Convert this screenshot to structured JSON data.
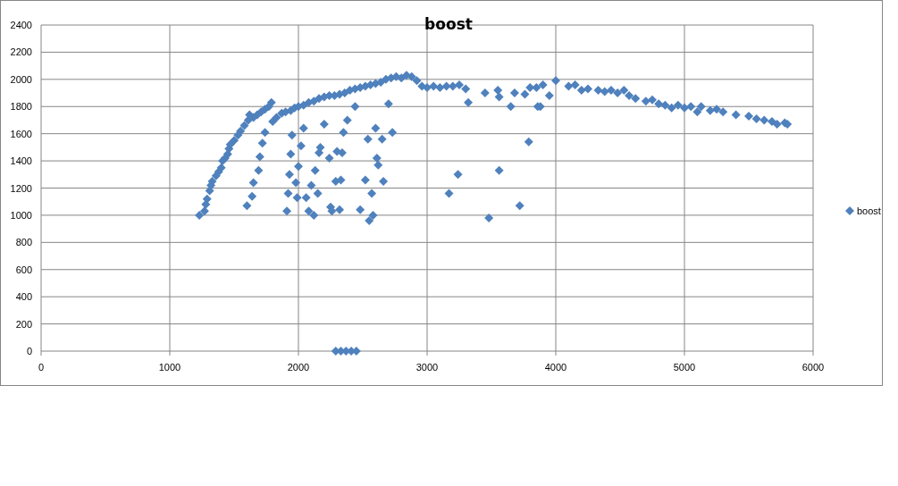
{
  "chart": {
    "chart_data": {
      "type": "scatter",
      "title": "boost",
      "grid": true,
      "xlim": [
        0,
        6000
      ],
      "ylim": [
        0,
        2400
      ],
      "xticks": [
        0,
        1000,
        2000,
        3000,
        4000,
        5000,
        6000
      ],
      "yticks": [
        0,
        200,
        400,
        600,
        800,
        1000,
        1200,
        1400,
        1600,
        1800,
        2000,
        2200,
        2400
      ],
      "x": [
        1230,
        1270,
        1280,
        1290,
        1310,
        1320,
        1330,
        1360,
        1380,
        1400,
        1410,
        1430,
        1450,
        1460,
        1470,
        1500,
        1530,
        1550,
        1580,
        1610,
        1620,
        1650,
        1680,
        1710,
        1740,
        1770,
        1790,
        1800,
        1830,
        1870,
        1900,
        1940,
        1970,
        2000,
        2040,
        2080,
        2120,
        2160,
        2200,
        2240,
        2280,
        2320,
        2360,
        2400,
        2440,
        2480,
        2520,
        2560,
        2600,
        2640,
        2680,
        2720,
        2760,
        2800,
        2840,
        2880,
        2920,
        2960,
        3000,
        3050,
        3100,
        3150,
        3200,
        3250,
        3300,
        3320,
        3450,
        3550,
        3560,
        3650,
        3680,
        3760,
        3800,
        3850,
        3880,
        3900,
        3950,
        4000,
        4100,
        4150,
        4200,
        4250,
        4330,
        4380,
        4430,
        4480,
        4530,
        4570,
        4620,
        4700,
        4750,
        4800,
        4850,
        4900,
        4950,
        5000,
        5050,
        5100,
        5130,
        5200,
        5250,
        5300,
        5400,
        5500,
        5560,
        5620,
        5680,
        5720,
        5780,
        5800,
        1600,
        1640,
        1650,
        1690,
        1700,
        1720,
        1740,
        1910,
        1920,
        1930,
        1940,
        1950,
        1980,
        1990,
        2000,
        2020,
        2040,
        2060,
        2080,
        2100,
        2120,
        2130,
        2150,
        2160,
        2170,
        2200,
        2240,
        2250,
        2260,
        2290,
        2300,
        2320,
        2330,
        2340,
        2350,
        2380,
        2440,
        2480,
        2520,
        2540,
        2550,
        2570,
        2580,
        2600,
        2610,
        2620,
        2650,
        2660,
        2700,
        2730,
        3170,
        3240,
        3480,
        3560,
        3720,
        3790,
        3860,
        2290,
        2330,
        2370,
        2410,
        2450
      ],
      "series": [
        {
          "name": "boost",
          "color": "#4f81bd",
          "values": [
            1000,
            1030,
            1080,
            1120,
            1180,
            1220,
            1250,
            1290,
            1320,
            1350,
            1400,
            1420,
            1450,
            1490,
            1520,
            1550,
            1590,
            1620,
            1660,
            1700,
            1740,
            1720,
            1740,
            1760,
            1780,
            1800,
            1830,
            1690,
            1720,
            1750,
            1760,
            1770,
            1790,
            1800,
            1810,
            1830,
            1840,
            1860,
            1870,
            1880,
            1880,
            1890,
            1900,
            1920,
            1930,
            1940,
            1950,
            1960,
            1970,
            1980,
            2000,
            2010,
            2020,
            2010,
            2030,
            2020,
            1990,
            1950,
            1940,
            1950,
            1940,
            1950,
            1950,
            1960,
            1930,
            1830,
            1900,
            1920,
            1870,
            1800,
            1900,
            1890,
            1940,
            1940,
            1800,
            1960,
            1880,
            1990,
            1950,
            1960,
            1920,
            1930,
            1920,
            1910,
            1920,
            1900,
            1920,
            1880,
            1860,
            1840,
            1850,
            1820,
            1810,
            1790,
            1810,
            1790,
            1800,
            1760,
            1800,
            1770,
            1780,
            1760,
            1740,
            1730,
            1710,
            1700,
            1690,
            1670,
            1680,
            1670,
            1070,
            1140,
            1240,
            1330,
            1430,
            1530,
            1610,
            1030,
            1160,
            1300,
            1450,
            1590,
            1240,
            1130,
            1360,
            1510,
            1640,
            1130,
            1030,
            1220,
            1000,
            1330,
            1160,
            1460,
            1500,
            1670,
            1420,
            1060,
            1030,
            1250,
            1470,
            1040,
            1260,
            1460,
            1610,
            1700,
            1800,
            1040,
            1260,
            1560,
            960,
            1160,
            1000,
            1640,
            1420,
            1370,
            1560,
            1250,
            1820,
            1610,
            1160,
            1300,
            980,
            1330,
            1070,
            1540,
            1800,
            0,
            0,
            0,
            0,
            0
          ]
        }
      ]
    }
  }
}
